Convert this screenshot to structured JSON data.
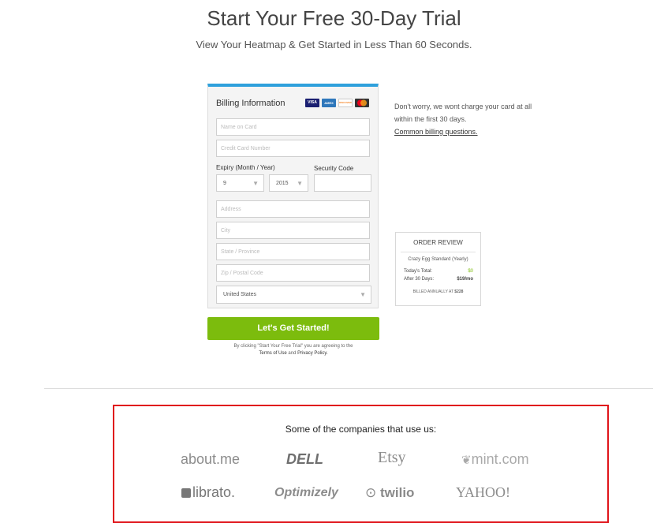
{
  "header": {
    "title": "Start Your Free 30-Day Trial",
    "subtitle": "View Your Heatmap & Get Started in Less Than 60 Seconds."
  },
  "billing": {
    "title": "Billing Information",
    "cards": [
      "VISA",
      "AMEX",
      "DISCOVER",
      "MASTERCARD"
    ],
    "name_placeholder": "Name on Card",
    "card_placeholder": "Credit Card Number",
    "expiry_label": "Expiry (Month / Year)",
    "security_label": "Security Code",
    "month_value": "9",
    "year_value": "2015",
    "address_placeholder": "Address",
    "city_placeholder": "City",
    "state_placeholder": "State / Province",
    "zip_placeholder": "Zip / Postal Code",
    "country_value": "United States"
  },
  "cta": {
    "label": "Let's Get Started!",
    "terms_prefix": "By clicking \"Start Your Free Trial\" you are agreeing to the",
    "terms_link": "Terms of Use",
    "and": "and",
    "privacy_link": "Privacy Policy."
  },
  "reassure": {
    "text": "Don't worry, we wont charge your card at all within the first 30 days.",
    "link": "Common billing questions."
  },
  "review": {
    "title": "ORDER REVIEW",
    "plan": "Crazy Egg Standard (Yearly)",
    "today_label": "Today's Total:",
    "today_value": "$0",
    "after_label": "After 30 Days:",
    "after_value": "$19/mo",
    "billed_prefix": "BILLED ANNUALLY AT",
    "billed_value": "$228"
  },
  "customers": {
    "heading": "Some of the companies that use us:",
    "logos": [
      "about.me",
      "DELL",
      "Etsy",
      "mint.com",
      "librato.",
      "Optimizely",
      "twilio",
      "YAHOO!"
    ]
  },
  "colors": {
    "accent": "#2ea0dc",
    "cta": "#7cbc0d",
    "price_green": "#7cbc0d",
    "highlight_border": "#e0151b"
  }
}
